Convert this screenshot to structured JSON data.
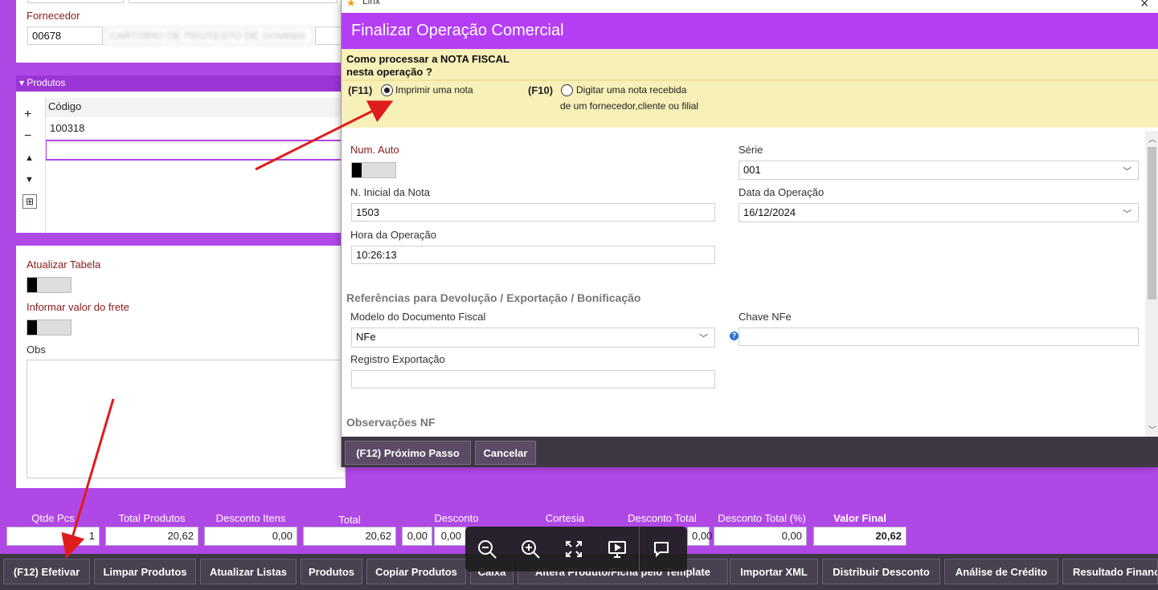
{
  "fornecedor": {
    "label": "Fornecedor",
    "code": "00678",
    "name": "CARTORIO DE PROTESTO DE GOIANIA"
  },
  "produtos": {
    "header": "Produtos",
    "col_codigo": "Código",
    "row1_codigo": "100318",
    "tools": {
      "add": "+",
      "remove": "−",
      "up": "▲",
      "down": "▼"
    }
  },
  "left_options": {
    "atualizar_tabela": "Atualizar Tabela",
    "informar_frete": "Informar valor do frete",
    "obs": "Obs"
  },
  "totals": {
    "qtde_pcs": {
      "label": "Qtde Pcs",
      "value": "1"
    },
    "total_produtos": {
      "label": "Total Produtos",
      "value": "20,62"
    },
    "desconto_itens": {
      "label": "Desconto Itens",
      "value": "0,00"
    },
    "total": {
      "label": "Total",
      "value": "20,62"
    },
    "desconto": {
      "label": "Desconto",
      "value1": "0,00",
      "value2": "0,00"
    },
    "cortesia": {
      "label": "Cortesia"
    },
    "desconto_total": {
      "label": "Desconto Total",
      "value": "0,00"
    },
    "desconto_total_pct": {
      "label": "Desconto Total (%)",
      "value": "0,00"
    },
    "valor_final": {
      "label": "Valor Final",
      "value": "20,62"
    }
  },
  "bottom_buttons": [
    "(F12) Efetivar",
    "Limpar Produtos",
    "Atualizar Listas",
    "Produtos",
    "Copiar Produtos",
    "Caixa",
    "Altera Produto/Ficha pelo Template",
    "Importar XML",
    "Distribuir Desconto",
    "Análise de Crédito",
    "Resultado Financ"
  ],
  "dialog": {
    "window_title": "Linx",
    "close": "×",
    "title": "Finalizar Operação Comercial",
    "question_line1": "Como processar a NOTA FISCAL",
    "question_line2": "nesta operação ?",
    "opt1_key": "(F11)",
    "opt1_label": "Imprimir uma nota",
    "opt2_key": "(F10)",
    "opt2_line1": "Digitar uma nota recebida",
    "opt2_line2": "de um fornecedor,cliente ou filial",
    "num_auto_label": "Num. Auto",
    "serie_label": "Série",
    "serie_value": "001",
    "n_inicial_label": "N. Inicial da Nota",
    "n_inicial_value": "1503",
    "data_label": "Data da Operação",
    "data_value": "16/12/2024",
    "hora_label": "Hora da Operação",
    "hora_value": "10:26:13",
    "ref_section": "Referências para Devolução / Exportação / Bonificação",
    "modelo_label": "Modelo do Documento Fiscal",
    "modelo_value": "NFe",
    "chave_label": "Chave NFe",
    "chave_value": "",
    "registro_label": "Registro Exportação",
    "registro_value": "",
    "obs_section": "Observações NF",
    "btn_next": "(F12) Próximo Passo",
    "btn_cancel": "Cancelar"
  },
  "viewer_toolbar": [
    "zoom-out-icon",
    "zoom-in-icon",
    "fullscreen-icon",
    "slideshow-icon",
    "comment-icon"
  ],
  "colors": {
    "purple": "#b048e6",
    "dark": "#4a4150",
    "dialog_title": "#b53ef5",
    "yellow": "#f7f0b8",
    "arrow": "#e01b1b"
  }
}
